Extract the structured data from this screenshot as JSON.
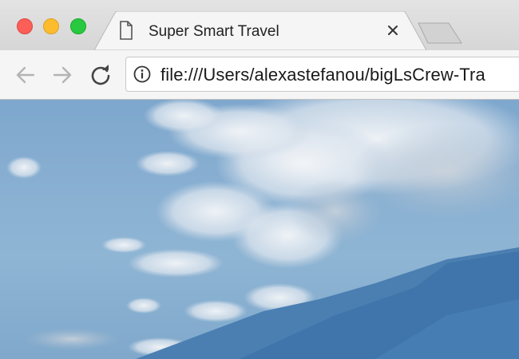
{
  "window": {
    "controls": [
      "close",
      "minimize",
      "maximize"
    ]
  },
  "tab": {
    "title": "Super Smart Travel",
    "icon": "page-icon",
    "close_icon": "close-icon"
  },
  "toolbar": {
    "back_icon": "back-arrow-icon",
    "forward_icon": "forward-arrow-icon",
    "reload_icon": "reload-icon"
  },
  "address_bar": {
    "icon": "info-icon",
    "url": "file:///Users/alexastefanou/bigLsCrew-Tra"
  },
  "colors": {
    "tabstrip": "#dadada",
    "toolbar": "#f5f5f5",
    "sky": "#89b0d2",
    "mountain": "#3f77ac"
  }
}
